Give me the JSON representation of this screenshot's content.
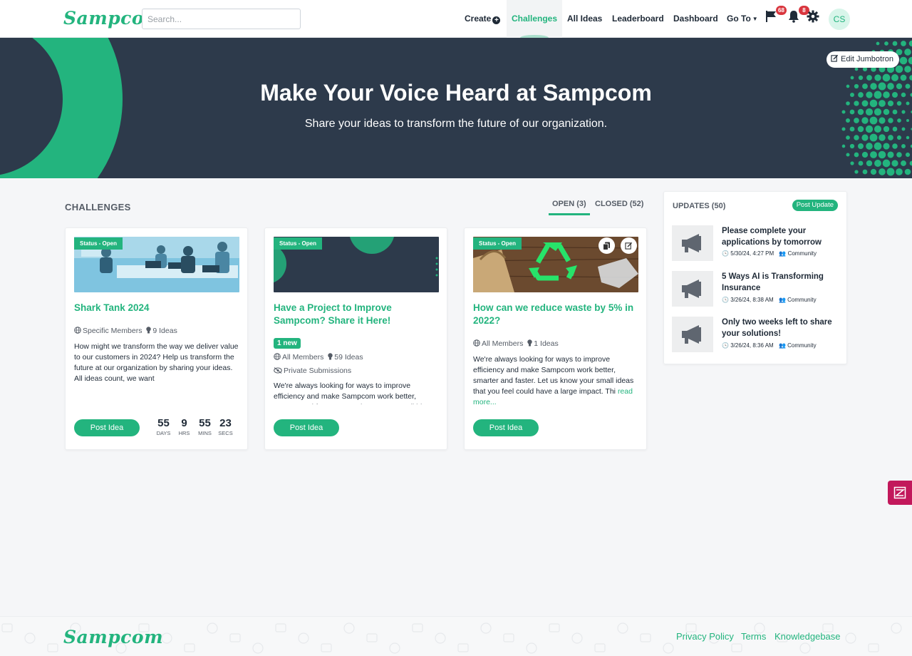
{
  "brand": {
    "logo_text": "Sampcom",
    "accent": "#23b47e",
    "dark": "#2d3a4b",
    "alert": "#d9363e"
  },
  "nav": {
    "search_placeholder": "Search...",
    "create": "Create",
    "challenges": "Challenges",
    "all_ideas": "All Ideas",
    "leaderboard": "Leaderboard",
    "dashboard": "Dashboard",
    "go_to": "Go To",
    "flag_badge": "68",
    "bell_badge": "8",
    "avatar_initials": "CS"
  },
  "jumbotron": {
    "title": "Make Your Voice Heard at Sampcom",
    "subtitle": "Share your ideas to transform the future of our organization.",
    "edit_label": "Edit Jumbotron"
  },
  "challenges": {
    "section_title": "CHALLENGES",
    "tab_open": "OPEN (3)",
    "tab_closed": "CLOSED (52)",
    "cards": [
      {
        "status": "Status - Open",
        "title": "Shark Tank 2024",
        "audience": "Specific Members",
        "ideas": "9 Ideas",
        "description": "How might we transform the way we deliver value to our customers in 2024? Help us transform the future at our organization by sharing your ideas. All ideas count, we want",
        "post_label": "Post Idea",
        "countdown": [
          {
            "value": "55",
            "unit": "DAYS"
          },
          {
            "value": "9",
            "unit": "HRS"
          },
          {
            "value": "55",
            "unit": "MINS"
          },
          {
            "value": "23",
            "unit": "SECS"
          }
        ]
      },
      {
        "status": "Status - Open",
        "title": "Have a Project to Improve Sampcom? Share it Here!",
        "new_badge": "1 new",
        "audience": "All Members",
        "ideas": "59 Ideas",
        "privacy": "Private Submissions",
        "description": "We're always looking for ways to improve efficiency and make Sampcom work better, smarter and faster. Let us know your small ideas",
        "post_label": "Post Idea"
      },
      {
        "status": "Status - Open",
        "title": "How can we reduce waste by 5% in 2022?",
        "audience": "All Members",
        "ideas": "1 Ideas",
        "description": "We're always looking for ways to improve efficiency and make Sampcom work better, smarter and faster. Let us know your small ideas that you feel could have a large impact. Thi",
        "read_more": "read more...",
        "post_label": "Post Idea"
      }
    ]
  },
  "updates": {
    "title": "UPDATES (50)",
    "post_label": "Post Update",
    "items": [
      {
        "title": "Please complete your applications by tomorrow",
        "date": "5/30/24, 4:27 PM",
        "group": "Community"
      },
      {
        "title": "5 Ways AI is Transforming Insurance",
        "date": "3/26/24, 8:38 AM",
        "group": "Community"
      },
      {
        "title": "Only two weeks left to share your solutions!",
        "date": "3/26/24, 8:36 AM",
        "group": "Community"
      }
    ]
  },
  "footer": {
    "logo_text": "Sampcom",
    "privacy": "Privacy Policy",
    "terms": "Terms",
    "kb": "Knowledgebase"
  }
}
